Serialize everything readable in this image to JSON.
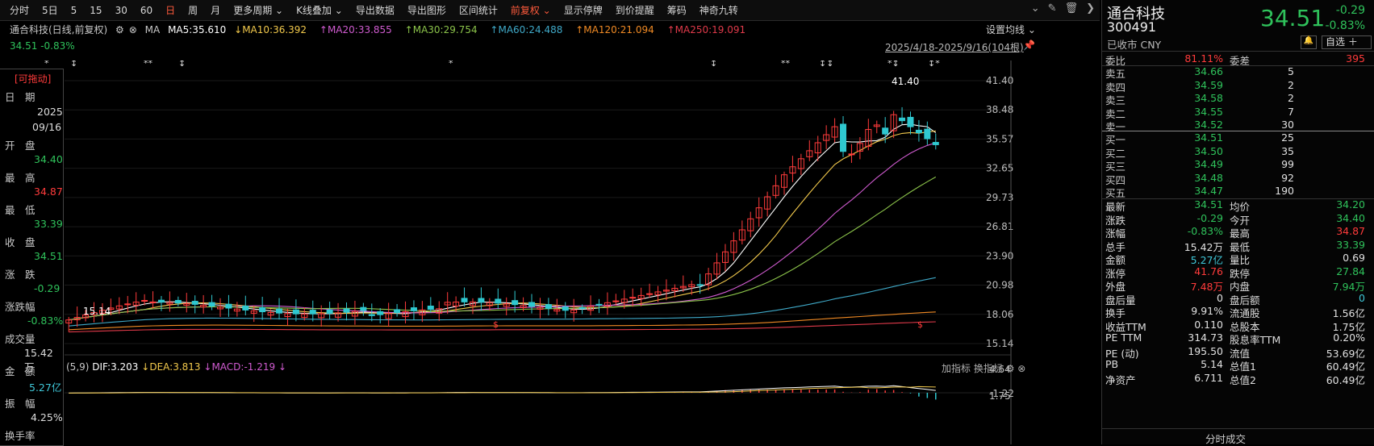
{
  "toolbar": {
    "items": [
      "分时",
      "5日",
      "5",
      "15",
      "30",
      "60",
      "日",
      "周",
      "月",
      "更多周期",
      "K线叠加",
      "导出数据",
      "导出图形",
      "区间统计",
      "前复权",
      "显示停牌",
      "到价提醒",
      "筹码",
      "神奇九转"
    ]
  },
  "header": {
    "stock_label": "通合科技(日线,前复权)",
    "ma_tag": "MA",
    "ma5": "MA5:35.610",
    "ma10": "MA10:36.392",
    "ma20": "MA20:33.855",
    "ma30": "MA30:29.754",
    "ma60": "MA60:24.488",
    "ma120": "MA120:21.094",
    "ma250": "MA250:19.091",
    "set_ma": "设置均线",
    "price": "34.51",
    "change_pct": "-0.83%",
    "range": "2025/4/18-2025/9/16(104根)",
    "high_label": "41.40",
    "low_label": "15.14"
  },
  "y_axis": [
    "41.40",
    "38.48",
    "35.57",
    "32.65",
    "29.73",
    "26.81",
    "23.90",
    "20.98",
    "18.06",
    "15.14"
  ],
  "macd": {
    "label": "(5,9)",
    "dif": "DIF:3.203",
    "dea": "DEA:3.813",
    "macd": "MACD:-1.219",
    "add_indicator": "加指标",
    "change_indicator": "换指标",
    "y_axis": [
      "4.64",
      "1.75",
      "-1.22"
    ]
  },
  "left_panel": {
    "draggable": "[可拖动]",
    "date_label": "日　期",
    "year": "2025",
    "date": "09/16",
    "open_label": "开　盘",
    "open": "34.40",
    "high_label": "最　高",
    "high": "34.87",
    "low_label": "最　低",
    "low": "33.39",
    "close_label": "收　盘",
    "close": "34.51",
    "chg_label": "涨　跌",
    "chg": "-0.29",
    "chgpct_label": "涨跌幅",
    "chgpct": "-0.83%",
    "vol_label": "成交量",
    "vol": "15.42万",
    "amt_label": "金　额",
    "amt": "5.27亿",
    "amp_label": "振　幅",
    "amp": "4.25%",
    "turnover_label": "换手率"
  },
  "quote": {
    "name": "通合科技",
    "code": "300491",
    "status": "已收市 CNY",
    "price": "34.51",
    "chg": "-0.29",
    "chgpct": "-0.83%",
    "watch_btn": "自选",
    "weibi_label": "委比",
    "weibi": "81.11%",
    "weicha_label": "委差",
    "weicha": "395",
    "asks": [
      {
        "label": "卖五",
        "price": "34.66",
        "vol": "5"
      },
      {
        "label": "卖四",
        "price": "34.59",
        "vol": "2"
      },
      {
        "label": "卖三",
        "price": "34.58",
        "vol": "2"
      },
      {
        "label": "卖二",
        "price": "34.55",
        "vol": "7"
      },
      {
        "label": "卖一",
        "price": "34.52",
        "vol": "30"
      }
    ],
    "bids": [
      {
        "label": "买一",
        "price": "34.51",
        "vol": "25"
      },
      {
        "label": "买二",
        "price": "34.50",
        "vol": "35"
      },
      {
        "label": "买三",
        "price": "34.49",
        "vol": "99"
      },
      {
        "label": "买四",
        "price": "34.48",
        "vol": "92"
      },
      {
        "label": "买五",
        "price": "34.47",
        "vol": "190"
      }
    ],
    "stats": [
      {
        "l1": "最新",
        "v1": "34.51",
        "c1": "green",
        "l2": "均价",
        "v2": "34.20",
        "c2": "green"
      },
      {
        "l1": "涨跌",
        "v1": "-0.29",
        "c1": "green",
        "l2": "今开",
        "v2": "34.40",
        "c2": "green"
      },
      {
        "l1": "涨幅",
        "v1": "-0.83%",
        "c1": "green",
        "l2": "最高",
        "v2": "34.87",
        "c2": "red"
      },
      {
        "l1": "总手",
        "v1": "15.42万",
        "c1": "white",
        "l2": "最低",
        "v2": "33.39",
        "c2": "green"
      },
      {
        "l1": "金额",
        "v1": "5.27亿",
        "c1": "cyan",
        "l2": "量比",
        "v2": "0.69",
        "c2": "white"
      },
      {
        "l1": "涨停",
        "v1": "41.76",
        "c1": "red",
        "l2": "跌停",
        "v2": "27.84",
        "c2": "green"
      },
      {
        "l1": "外盘",
        "v1": "7.48万",
        "c1": "red",
        "l2": "内盘",
        "v2": "7.94万",
        "c2": "green"
      },
      {
        "l1": "盘后量",
        "v1": "0",
        "c1": "white",
        "l2": "盘后额",
        "v2": "0",
        "c2": "cyan"
      },
      {
        "l1": "换手",
        "v1": "9.91%",
        "c1": "white",
        "l2": "流通股",
        "v2": "1.56亿",
        "c2": "white"
      },
      {
        "l1": "收益TTM",
        "v1": "0.110",
        "c1": "white",
        "l2": "总股本",
        "v2": "1.75亿",
        "c2": "white"
      },
      {
        "l1": "PE TTM",
        "v1": "314.73",
        "c1": "white",
        "l2": "股息率TTM",
        "v2": "0.20%",
        "c2": "white"
      },
      {
        "l1": "PE (动)",
        "v1": "195.50",
        "c1": "white",
        "l2": "流值",
        "v2": "53.69亿",
        "c2": "white"
      },
      {
        "l1": "PB",
        "v1": "5.14",
        "c1": "white",
        "l2": "总值1",
        "v2": "60.49亿",
        "c2": "white"
      },
      {
        "l1": "净资产",
        "v1": "6.711",
        "c1": "white",
        "l2": "总值2",
        "v2": "60.49亿",
        "c2": "white"
      }
    ],
    "footer": "分时成交"
  },
  "colors": {
    "up": "#ff3b3b",
    "down": "#2fc8d0",
    "ma5": "#ffffff",
    "ma10": "#f2c94c",
    "ma20": "#d05bd0",
    "ma30": "#8bc34a",
    "ma60": "#3fa9c8",
    "ma120": "#f08a24",
    "ma250": "#e03a4a"
  }
}
